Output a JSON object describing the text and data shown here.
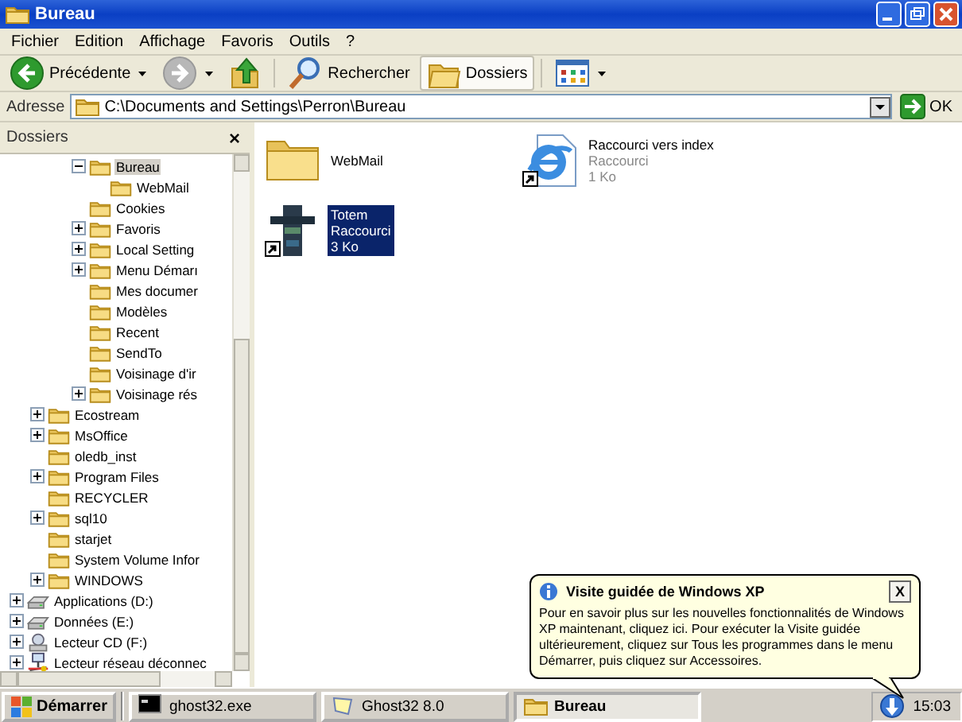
{
  "window": {
    "title": "Bureau"
  },
  "menu": [
    "Fichier",
    "Edition",
    "Affichage",
    "Favoris",
    "Outils",
    "?"
  ],
  "toolbar": [
    {
      "kind": "back",
      "label": "Précédente",
      "disabled": false
    },
    {
      "kind": "forward",
      "disabled": true
    },
    {
      "kind": "up"
    },
    {
      "kind": "search",
      "label": "Rechercher"
    },
    {
      "kind": "folders",
      "label": "Dossiers",
      "pressed": true
    },
    {
      "kind": "views"
    }
  ],
  "address": {
    "label": "Adresse",
    "value": "C:\\Documents and Settings\\Perron\\Bureau",
    "go": "OK"
  },
  "folders_pane": {
    "title": "Dossiers",
    "close": "×"
  },
  "tree": [
    {
      "children": [
        {
          "children": [
            {
              "children": [
                {
                  "label": "Bureau",
                  "kind": "folder",
                  "expanded": true,
                  "selected": true,
                  "children": [
                    {
                      "label": "WebMail",
                      "kind": "folder",
                      "selected": false
                    }
                  ]
                },
                {
                  "label": "Cookies",
                  "kind": "folder",
                  "selected": false
                },
                {
                  "label": "Favoris",
                  "kind": "folder",
                  "expanded": false,
                  "selected": false
                },
                {
                  "label": "Local Setting",
                  "kind": "folder",
                  "expanded": false,
                  "selected": false
                },
                {
                  "label": "Menu Démarı",
                  "kind": "folder",
                  "expanded": false,
                  "selected": false
                },
                {
                  "label": "Mes documer",
                  "kind": "folder",
                  "selected": false
                },
                {
                  "label": "Modèles",
                  "kind": "folder",
                  "selected": false
                },
                {
                  "label": "Recent",
                  "kind": "folder",
                  "selected": false
                },
                {
                  "label": "SendTo",
                  "kind": "folder",
                  "selected": false
                },
                {
                  "label": "Voisinage d'ir",
                  "kind": "folder",
                  "selected": false
                },
                {
                  "label": "Voisinage rés",
                  "kind": "folder",
                  "expanded": false,
                  "selected": false
                }
              ]
            }
          ]
        },
        {
          "label": "Ecostream",
          "kind": "folder",
          "expanded": false,
          "selected": false
        },
        {
          "label": "MsOffice",
          "kind": "folder",
          "expanded": false,
          "selected": false
        },
        {
          "label": "oledb_inst",
          "kind": "folder",
          "selected": false
        },
        {
          "label": "Program Files",
          "kind": "folder",
          "expanded": false,
          "selected": false
        },
        {
          "label": "RECYCLER",
          "kind": "folder",
          "selected": false
        },
        {
          "label": "sql10",
          "kind": "folder",
          "expanded": false,
          "selected": false
        },
        {
          "label": "starjet",
          "kind": "folder",
          "selected": false
        },
        {
          "label": "System Volume Infor",
          "kind": "folder",
          "selected": false
        },
        {
          "label": "WINDOWS",
          "kind": "folder",
          "expanded": false,
          "selected": false
        }
      ]
    },
    {
      "label": "Applications (D:)",
      "kind": "drive",
      "expanded": false,
      "selected": false
    },
    {
      "label": "Données (E:)",
      "kind": "drive",
      "expanded": false,
      "selected": false
    },
    {
      "label": "Lecteur CD (F:)",
      "kind": "cd",
      "expanded": false,
      "selected": false
    },
    {
      "label": "Lecteur réseau déconnec",
      "kind": "network",
      "expanded": false,
      "selected": false
    }
  ],
  "files": [
    {
      "kind": "folder",
      "name": "WebMail",
      "selected": false
    },
    {
      "kind": "ie-shortcut",
      "name": "Raccourci vers index",
      "type": "Raccourci",
      "size": "1 Ko",
      "selected": false
    },
    {
      "kind": "totem-shortcut",
      "name": "Totem",
      "type": "Raccourci",
      "size": "3 Ko",
      "selected": true
    }
  ],
  "balloon": {
    "title": "Visite guidée de Windows XP",
    "text": "Pour en savoir plus sur les nouvelles fonctionnalités de Windows XP maintenant, cliquez ici. Pour exécuter la Visite guidée ultérieurement, cliquez sur Tous les programmes dans le menu Démarrer, puis cliquez sur Accessoires.",
    "close": "X"
  },
  "taskbar": {
    "start": "Démarrer",
    "tasks": [
      {
        "kind": "console",
        "label": "ghost32.exe",
        "selected": false
      },
      {
        "kind": "ghost",
        "label": "Ghost32 8.0",
        "selected": false
      },
      {
        "kind": "folder",
        "label": "Bureau",
        "selected": true
      }
    ],
    "clock": "15:03"
  }
}
